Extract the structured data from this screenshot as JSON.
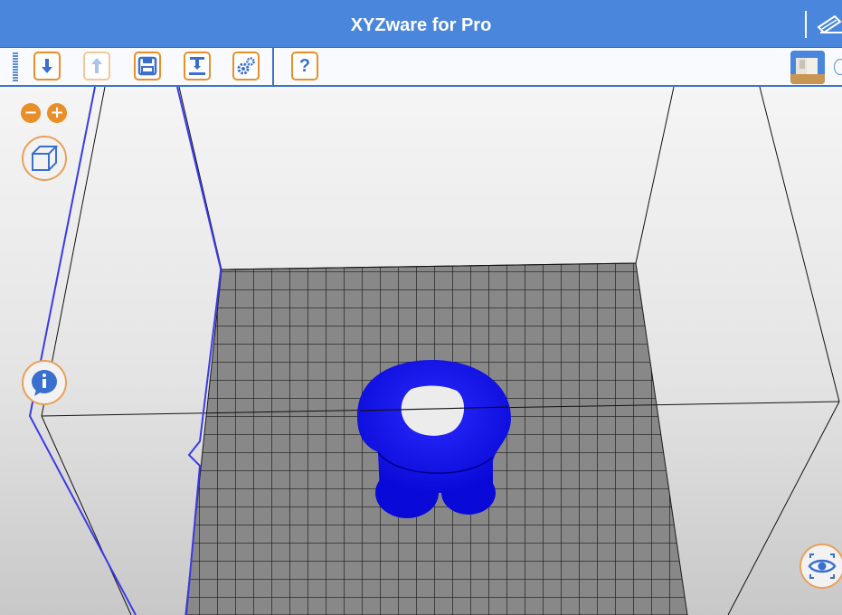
{
  "window": {
    "title": "XYZware for Pro"
  },
  "toolbar": {
    "buttons": [
      {
        "name": "import-button",
        "icon": "import-down-arrow-icon",
        "enabled": true
      },
      {
        "name": "export-button",
        "icon": "export-up-arrow-icon",
        "enabled": false
      },
      {
        "name": "save-button",
        "icon": "floppy-disk-icon",
        "enabled": true
      },
      {
        "name": "print-button",
        "icon": "printer-nozzle-icon",
        "enabled": true
      },
      {
        "name": "settings-button",
        "icon": "gears-icon",
        "enabled": true
      },
      {
        "name": "help-button",
        "icon": "question-mark-icon",
        "enabled": true,
        "label": "?"
      }
    ]
  },
  "viewport": {
    "zoom_out_label": "−",
    "zoom_in_label": "+",
    "buttons": [
      "zoom-out-button",
      "zoom-in-button",
      "view-cube-button",
      "info-button",
      "eye-view-button"
    ]
  },
  "colors": {
    "titlebar": "#4a86dc",
    "accent_orange": "#e98f2a",
    "model_blue": "#1010f0",
    "grid_cell": "#888888",
    "grid_line": "#1a1a1a"
  }
}
